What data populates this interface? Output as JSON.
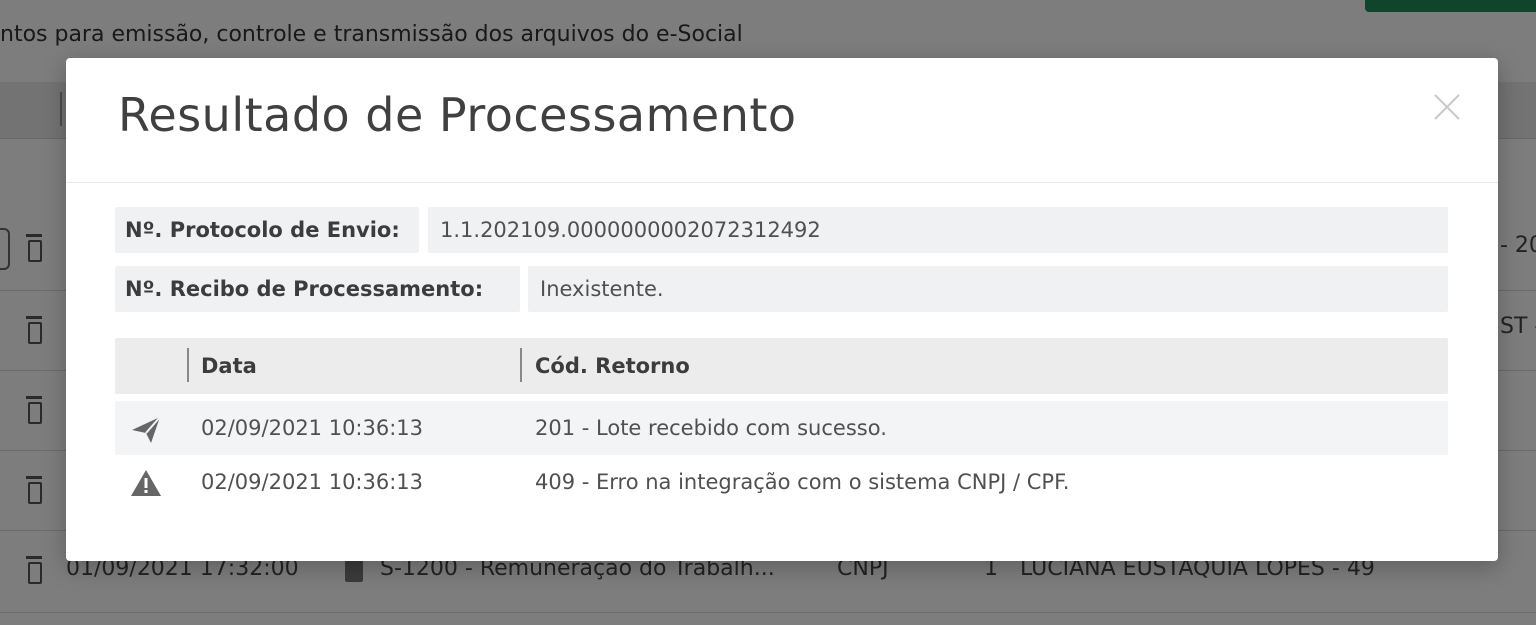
{
  "background": {
    "subtitle": "ntos para emissão, controle e transmissão dos arquivos do e-Social",
    "row_right_texts": [
      "- 20",
      "ST -"
    ],
    "last_row": {
      "datetime": "01/09/2021 17:32:00",
      "event": "S-1200 - Remuneração do Trabalh...",
      "doc_type": "CNPJ",
      "qty": "1",
      "name": "LUCIANA EUSTÁQUIA LOPES - 49"
    }
  },
  "modal": {
    "title": "Resultado de Processamento",
    "close_icon": "close-icon",
    "fields": [
      {
        "label": "Nº. Protocolo de Envio:",
        "value": "1.1.202109.0000000002072312492"
      },
      {
        "label": "Nº. Recibo de Processamento:",
        "value": "Inexistente."
      }
    ],
    "table": {
      "columns": [
        "Data",
        "Cód. Retorno"
      ],
      "rows": [
        {
          "icon": "send-icon",
          "date": "02/09/2021 10:36:13",
          "message": "201 - Lote recebido com sucesso."
        },
        {
          "icon": "warning-icon",
          "date": "02/09/2021 10:36:13",
          "message": "409 - Erro na integração com o sistema CNPJ / CPF."
        }
      ]
    }
  },
  "colors": {
    "accent_green": "#1f8a5b",
    "icon_gray": "#666666"
  }
}
